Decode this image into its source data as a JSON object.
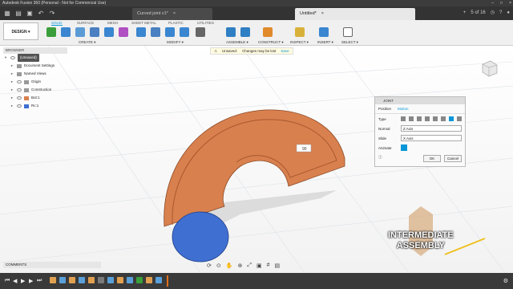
{
  "titlebar": {
    "title": "Autodesk Fusion 360 (Personal - Not for Commercial Use)"
  },
  "tabs": [
    {
      "label": "Curved joint v1*",
      "active": false
    },
    {
      "label": "Untitled*",
      "active": true
    }
  ],
  "tab_right": {
    "page": "5 of 16"
  },
  "workspace": {
    "label": "DESIGN ▾"
  },
  "ribbon_tabs": [
    "SOLID",
    "SURFACE",
    "MESH",
    "SHEET METAL",
    "PLASTIC",
    "UTILITIES"
  ],
  "ribbon_groups": [
    "CREATE ▾",
    "MODIFY ▾",
    "ASSEMBLE ▾",
    "CONSTRUCT ▾",
    "INSPECT ▾",
    "INSERT ▾",
    "SELECT ▾"
  ],
  "unsaved": {
    "label": "Unsaved:",
    "message": "Changes may be lost",
    "save": "Save"
  },
  "browser": {
    "header": "BROWSER",
    "root": "(Unsaved)",
    "items": [
      "Document Settings",
      "Named Views",
      "Origin",
      "Construction",
      "Bot:1",
      "Rc:1"
    ]
  },
  "joint_dialog": {
    "title": "JOINT",
    "tabs": [
      "Position",
      "Motion"
    ],
    "type_label": "Type",
    "normal_label": "Normal",
    "normal_value": "Z Axis",
    "slide_label": "Slide",
    "slide_value": "X Axis",
    "animate_label": "Animate",
    "ok": "OK",
    "cancel": "Cancel"
  },
  "value_box": "90",
  "comments": {
    "label": "COMMENTS"
  },
  "overlay": {
    "line1": "INTERMEDIATE",
    "line2": "ASSEMBLY"
  },
  "colors": {
    "accent": "#0696d7",
    "part_orange": "#d9804f",
    "part_blue": "#3f6fd1"
  }
}
